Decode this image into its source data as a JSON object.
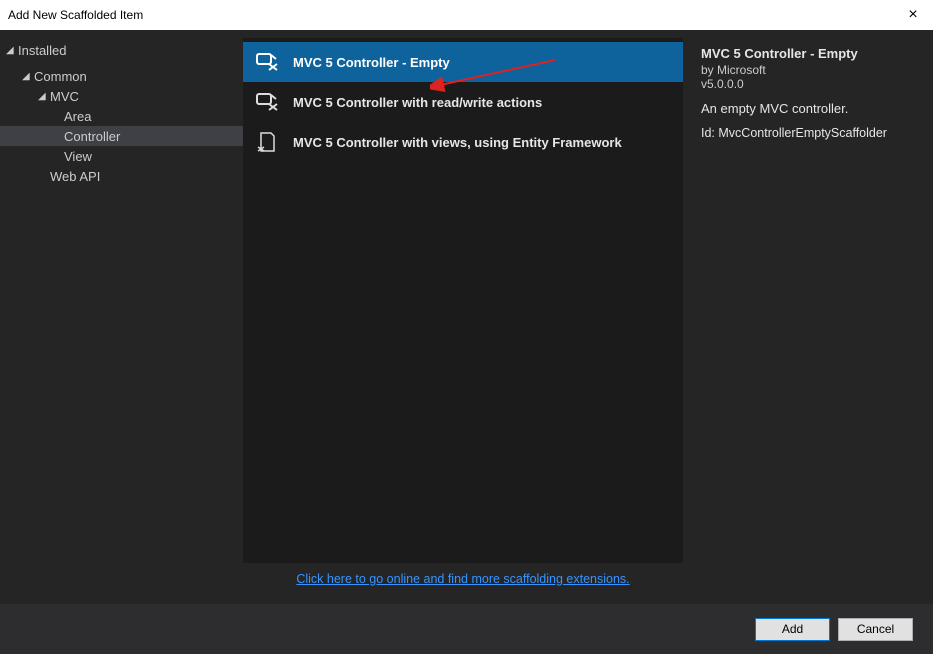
{
  "title": "Add New Scaffolded Item",
  "sidebar": {
    "root": "Installed",
    "items": {
      "common": "Common",
      "mvc": "MVC",
      "area": "Area",
      "controller": "Controller",
      "view": "View",
      "webapi": "Web API"
    }
  },
  "list": {
    "items": [
      {
        "label": "MVC 5 Controller - Empty"
      },
      {
        "label": "MVC 5 Controller with read/write actions"
      },
      {
        "label": "MVC 5 Controller with views, using Entity Framework"
      }
    ]
  },
  "details": {
    "title": "MVC 5 Controller - Empty",
    "by": "by Microsoft",
    "version": "v5.0.0.0",
    "desc": "An empty MVC controller.",
    "id_label": "Id:",
    "id_value": "MvcControllerEmptyScaffolder"
  },
  "link": "Click here to go online and find more scaffolding extensions.",
  "buttons": {
    "add": "Add",
    "cancel": "Cancel"
  }
}
